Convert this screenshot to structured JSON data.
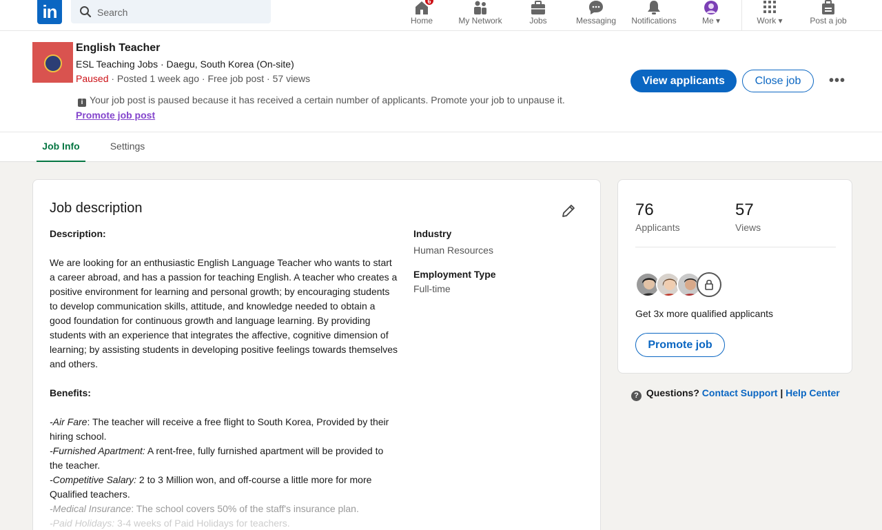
{
  "nav": {
    "search_placeholder": "Search",
    "items": [
      {
        "label": "Home",
        "icon": "home-icon",
        "badge": "6"
      },
      {
        "label": "My Network",
        "icon": "network-icon"
      },
      {
        "label": "Jobs",
        "icon": "briefcase-icon"
      },
      {
        "label": "Messaging",
        "icon": "messaging-icon"
      },
      {
        "label": "Notifications",
        "icon": "bell-icon"
      },
      {
        "label": "Me",
        "icon": "avatar-icon"
      },
      {
        "label": "Work",
        "icon": "grid-icon"
      },
      {
        "label": "Post a job",
        "icon": "post-job-icon"
      }
    ],
    "logo_text": "in"
  },
  "job": {
    "title": "English Teacher",
    "subtitle": "ESL Teaching Jobs · Daegu, South Korea (On-site)",
    "status": "Paused",
    "meta": " · Posted 1 week ago · Free job post · 57 views",
    "notice": "Your job post is paused because it has received a certain number of applicants. Promote your job to unpause it.",
    "promote_link": "Promote job post",
    "view_applicants": "View applicants",
    "close_job": "Close job"
  },
  "tabs": [
    {
      "label": "Job Info",
      "active": true
    },
    {
      "label": "Settings",
      "active": false
    }
  ],
  "description": {
    "title": "Job description",
    "heading": "Description:",
    "body": "We are looking for an enthusiastic English Language Teacher who wants to start a career abroad, and has a passion for teaching English. A teacher who creates a positive environment for learning and personal growth; by encouraging students to develop communication skills, attitude, and knowledge needed to obtain a good foundation for continuous growth and language learning. By providing students with an experience that integrates the affective, cognitive dimension of learning; by assisting students in developing positive feelings towards themselves and others.",
    "benefits_heading": "Benefits:",
    "benefits": [
      {
        "name": "-Air Fare",
        "text": ": The teacher will receive a free flight to South Korea, Provided by their hiring school."
      },
      {
        "name": "-Furnished Apartment:",
        "text": " A rent-free, fully furnished apartment will be provided to the teacher."
      },
      {
        "name": "-Competitive Salary:",
        "text": " 2 to 3 Million won, and off-course a little more for more Qualified teachers."
      },
      {
        "name": "-Medical Insurance",
        "text": ": The school covers 50% of the staff's insurance plan."
      },
      {
        "name": "-Paid Holidays:",
        "text": " 3-4 weeks of Paid Holidays for teachers."
      }
    ],
    "industry_label": "Industry",
    "industry_value": "Human Resources",
    "employment_label": "Employment Type",
    "employment_value": "Full-time"
  },
  "stats": {
    "applicants_count": "76",
    "applicants_label": "Applicants",
    "views_count": "57",
    "views_label": "Views",
    "qualified_text": "Get 3x more qualified applicants",
    "promote_button": "Promote job"
  },
  "help": {
    "questions": "Questions?",
    "contact": "Contact Support",
    "separator": "|",
    "help_center": "Help Center"
  },
  "colors": {
    "brand": "#0a66c2",
    "paused": "#cc1016",
    "active_tab": "#057642",
    "link_visited": "#8344cc"
  }
}
